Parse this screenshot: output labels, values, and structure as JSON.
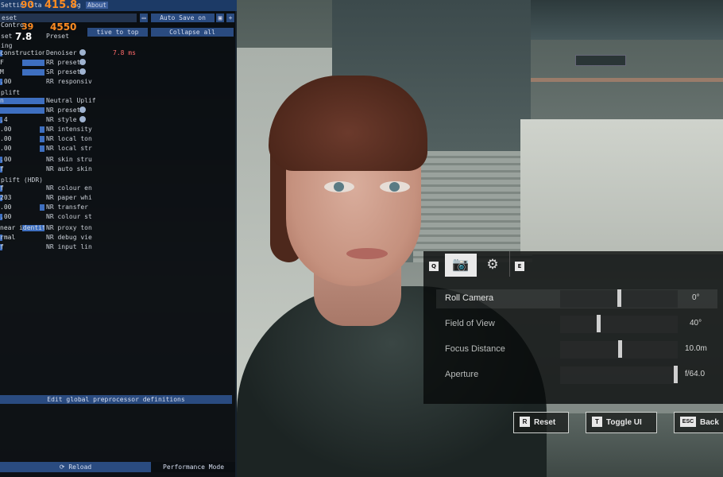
{
  "overlay": {
    "menubar": {
      "settings": "Settin",
      "statistics": "Sta",
      "log": "og",
      "about": "About"
    },
    "perf": {
      "fps": "90",
      "frametime": "415.8"
    },
    "stats_overlay": {
      "value_a": "39",
      "value_b": "4550",
      "frametime_ms": "7.8"
    },
    "toolbar": {
      "preset_value": "eset",
      "auto_save": "Auto Save on",
      "save_icon": "save-icon",
      "add_icon": "add-icon",
      "relative_to_top": "tive to top",
      "collapse_all": "Collapse all"
    },
    "left_header": {
      "control": "Contro",
      "preset_label": "Preset",
      "set": "set"
    },
    "section_1": "ing",
    "section_2": "plift",
    "section_3": "plift (HDR)",
    "rows": [
      {
        "val": "construction",
        "label": "Denoiser",
        "extra": "7.8 ms",
        "bar": 0.0,
        "icon": true
      },
      {
        "val": "F",
        "label": "RR preset",
        "bar": 0.45,
        "icon": true
      },
      {
        "val": "M",
        "label": "SR preset",
        "bar": 0.45,
        "icon": true
      },
      {
        "val": ".00",
        "label": "RR responsiv",
        "bar": 0.0,
        "icon": false
      },
      {
        "val": "n",
        "label": "Neutral Uplif",
        "bar": 1.0,
        "icon": false
      },
      {
        "val": "",
        "label": "NR preset",
        "bar": 1.0,
        "icon": true
      },
      {
        "val": ".4",
        "label": "NR style",
        "bar": 0.0,
        "icon": true
      },
      {
        "val": ".00",
        "label": "NR intensity",
        "bar": 0.95,
        "icon": false
      },
      {
        "val": ".00",
        "label": "NR local ton",
        "bar": 0.95,
        "icon": false
      },
      {
        "val": ".00",
        "label": "NR local str",
        "bar": 0.95,
        "icon": false
      },
      {
        "val": ".00",
        "label": "NR skin stru",
        "bar": 0.0,
        "icon": false
      },
      {
        "val": "f",
        "label": "NR auto skin",
        "bar": 0.0,
        "icon": false
      },
      {
        "val": "f",
        "label": "NR colour en",
        "bar": 0.0,
        "icon": false
      },
      {
        "val": "203",
        "label": "NR paper whi",
        "bar": 0.0,
        "icon": false
      },
      {
        "val": ".00",
        "label": "NR transfer",
        "bar": 0.95,
        "icon": false
      },
      {
        "val": ".00",
        "label": "NR colour st",
        "bar": 0.0,
        "icon": false
      },
      {
        "val": "near identity",
        "label": "NR proxy ton",
        "bar": 0.5,
        "icon": false
      },
      {
        "val": "rmal",
        "label": "NR debug vie",
        "bar": 0.0,
        "icon": false
      },
      {
        "val": "f",
        "label": "NR input lin",
        "bar": 0.0,
        "icon": false
      }
    ],
    "edit_button": "Edit global preprocessor definitions",
    "reload": "Reload",
    "performance_mode": "Performance Mode"
  },
  "photo_mode": {
    "tabs": [
      {
        "key": "Q"
      },
      {
        "icon": "camera-icon",
        "glyph": "📷"
      },
      {
        "icon": "filter-icon",
        "glyph": "⚙"
      },
      {
        "key": "E"
      }
    ],
    "sliders": [
      {
        "label": "Roll Camera",
        "value": "0°",
        "position": 0.5
      },
      {
        "label": "Field of View",
        "value": "40°",
        "position": 0.32
      },
      {
        "label": "Focus Distance",
        "value": "10.0m",
        "position": 0.51
      },
      {
        "label": "Aperture",
        "value": "f/64.0",
        "position": 1.0
      }
    ],
    "buttons": {
      "reset": {
        "key": "R",
        "label": "Reset"
      },
      "toggle_ui": {
        "key": "T",
        "label": "Toggle UI"
      },
      "back": {
        "key": "ESC",
        "label": "Back"
      }
    }
  },
  "scene": {
    "sign_text": ""
  }
}
